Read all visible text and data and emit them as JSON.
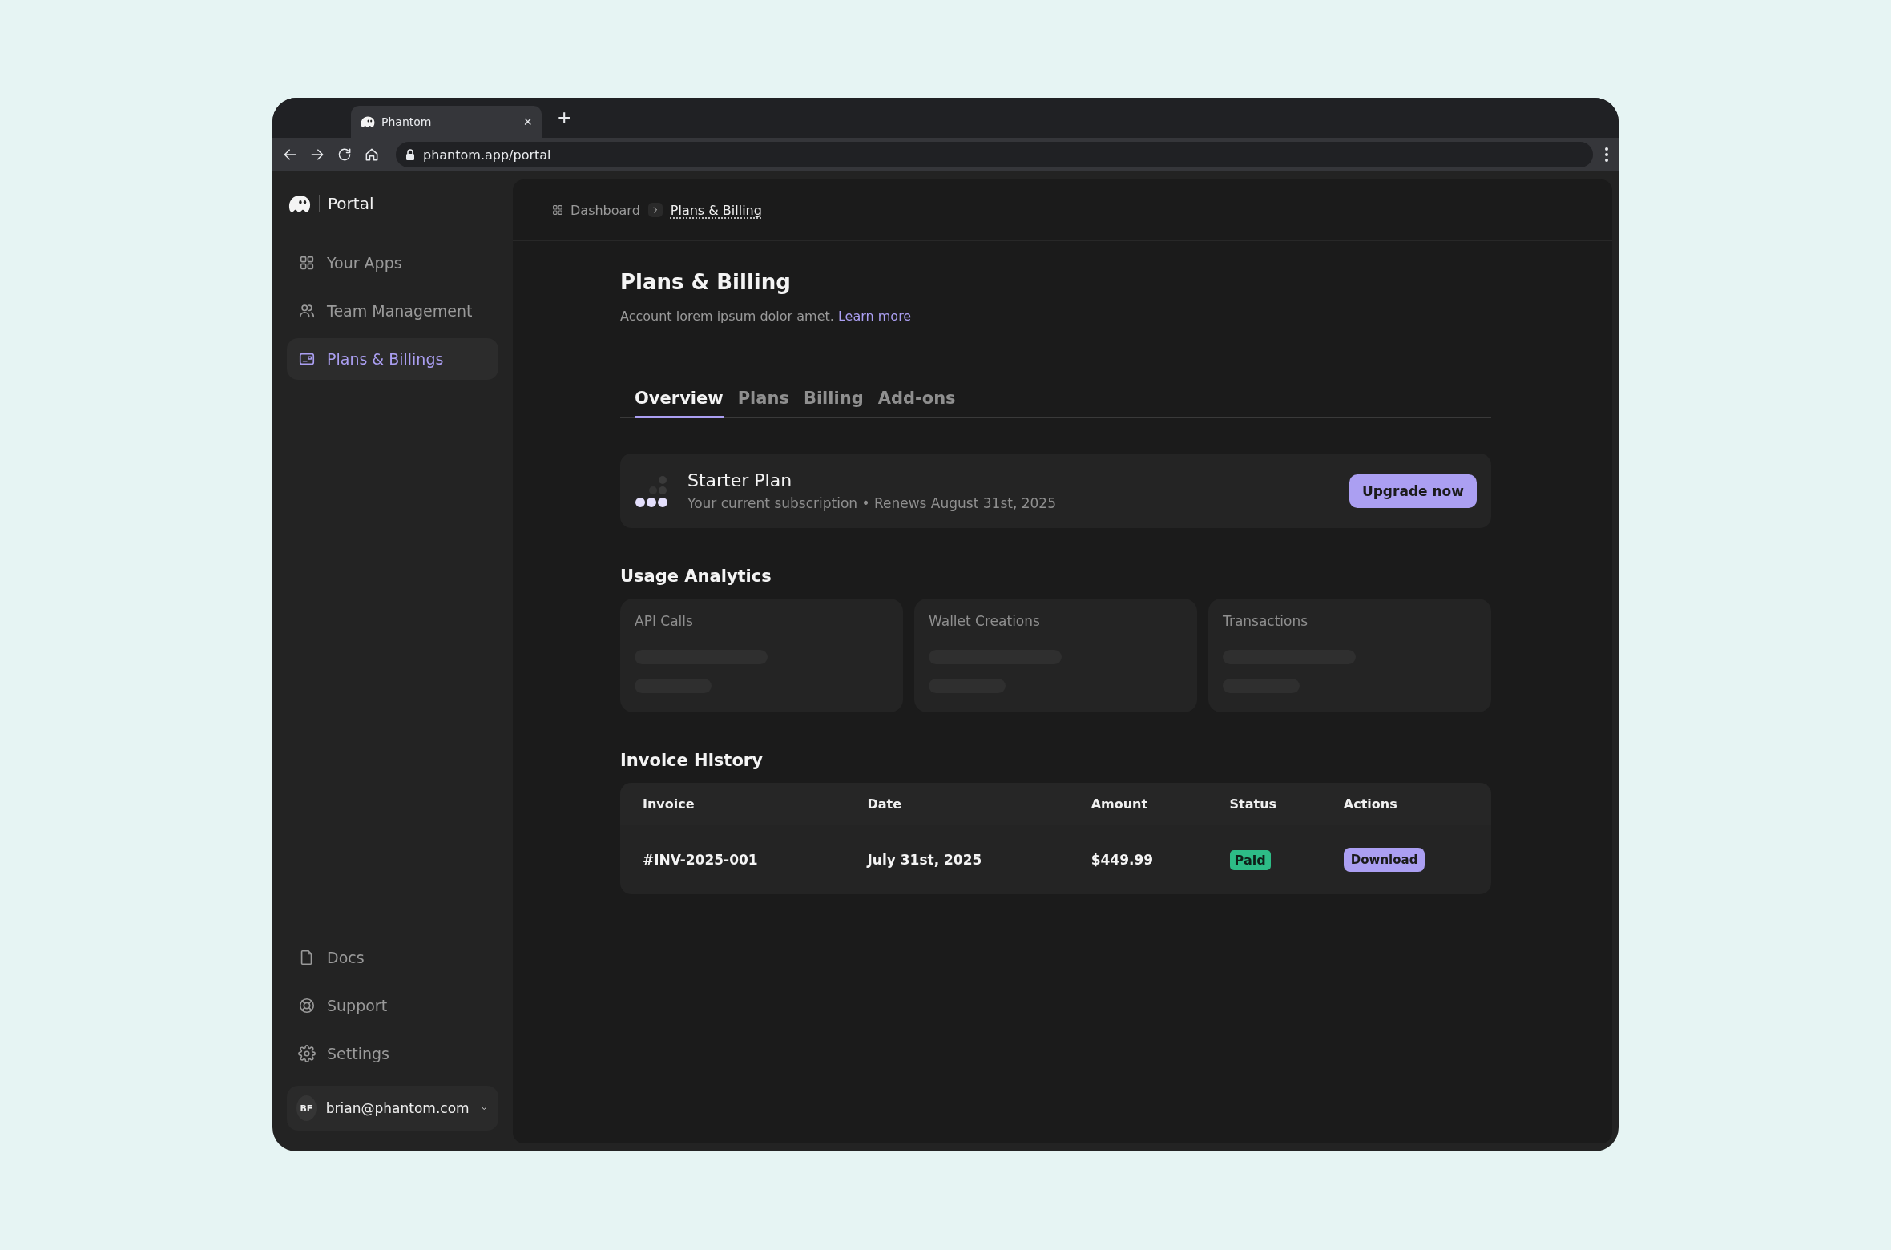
{
  "browser": {
    "tab_title": "Phantom",
    "tab_close": "×",
    "new_tab": "+",
    "url": "phantom.app/portal"
  },
  "sidebar": {
    "brand": "Portal",
    "items": [
      {
        "label": "Your Apps",
        "selected": false
      },
      {
        "label": "Team Management",
        "selected": false
      },
      {
        "label": "Plans & Billings",
        "selected": true
      }
    ],
    "footer_items": [
      {
        "label": "Docs"
      },
      {
        "label": "Support"
      },
      {
        "label": "Settings"
      }
    ],
    "user": {
      "initials": "BF",
      "email": "brian@phantom.com"
    }
  },
  "breadcrumb": [
    "Dashboard",
    "Plans & Billing"
  ],
  "page": {
    "title": "Plans & Billing",
    "description": "Account lorem ipsum dolor amet.",
    "link": "Learn more"
  },
  "tabs": [
    {
      "label": "Overview",
      "selected": true
    },
    {
      "label": "Plans",
      "selected": false
    },
    {
      "label": "Billing",
      "selected": false
    },
    {
      "label": "Add-ons",
      "selected": false
    }
  ],
  "plan": {
    "name": "Starter Plan",
    "subtitle": "Your current subscription • Renews August 31st, 2025",
    "button": "Upgrade now"
  },
  "analytics": {
    "title": "Usage Analytics",
    "cards": [
      {
        "label": "API Calls"
      },
      {
        "label": "Wallet Creations"
      },
      {
        "label": "Transactions"
      }
    ]
  },
  "invoices": {
    "title": "Invoice History",
    "columns": [
      "Invoice",
      "Date",
      "Amount",
      "Status",
      "Actions"
    ],
    "rows": [
      {
        "invoice": "#INV-2025-001",
        "date": "July 31st, 2025",
        "amount": "$449.99",
        "status": "Paid",
        "action": "Download"
      }
    ]
  }
}
